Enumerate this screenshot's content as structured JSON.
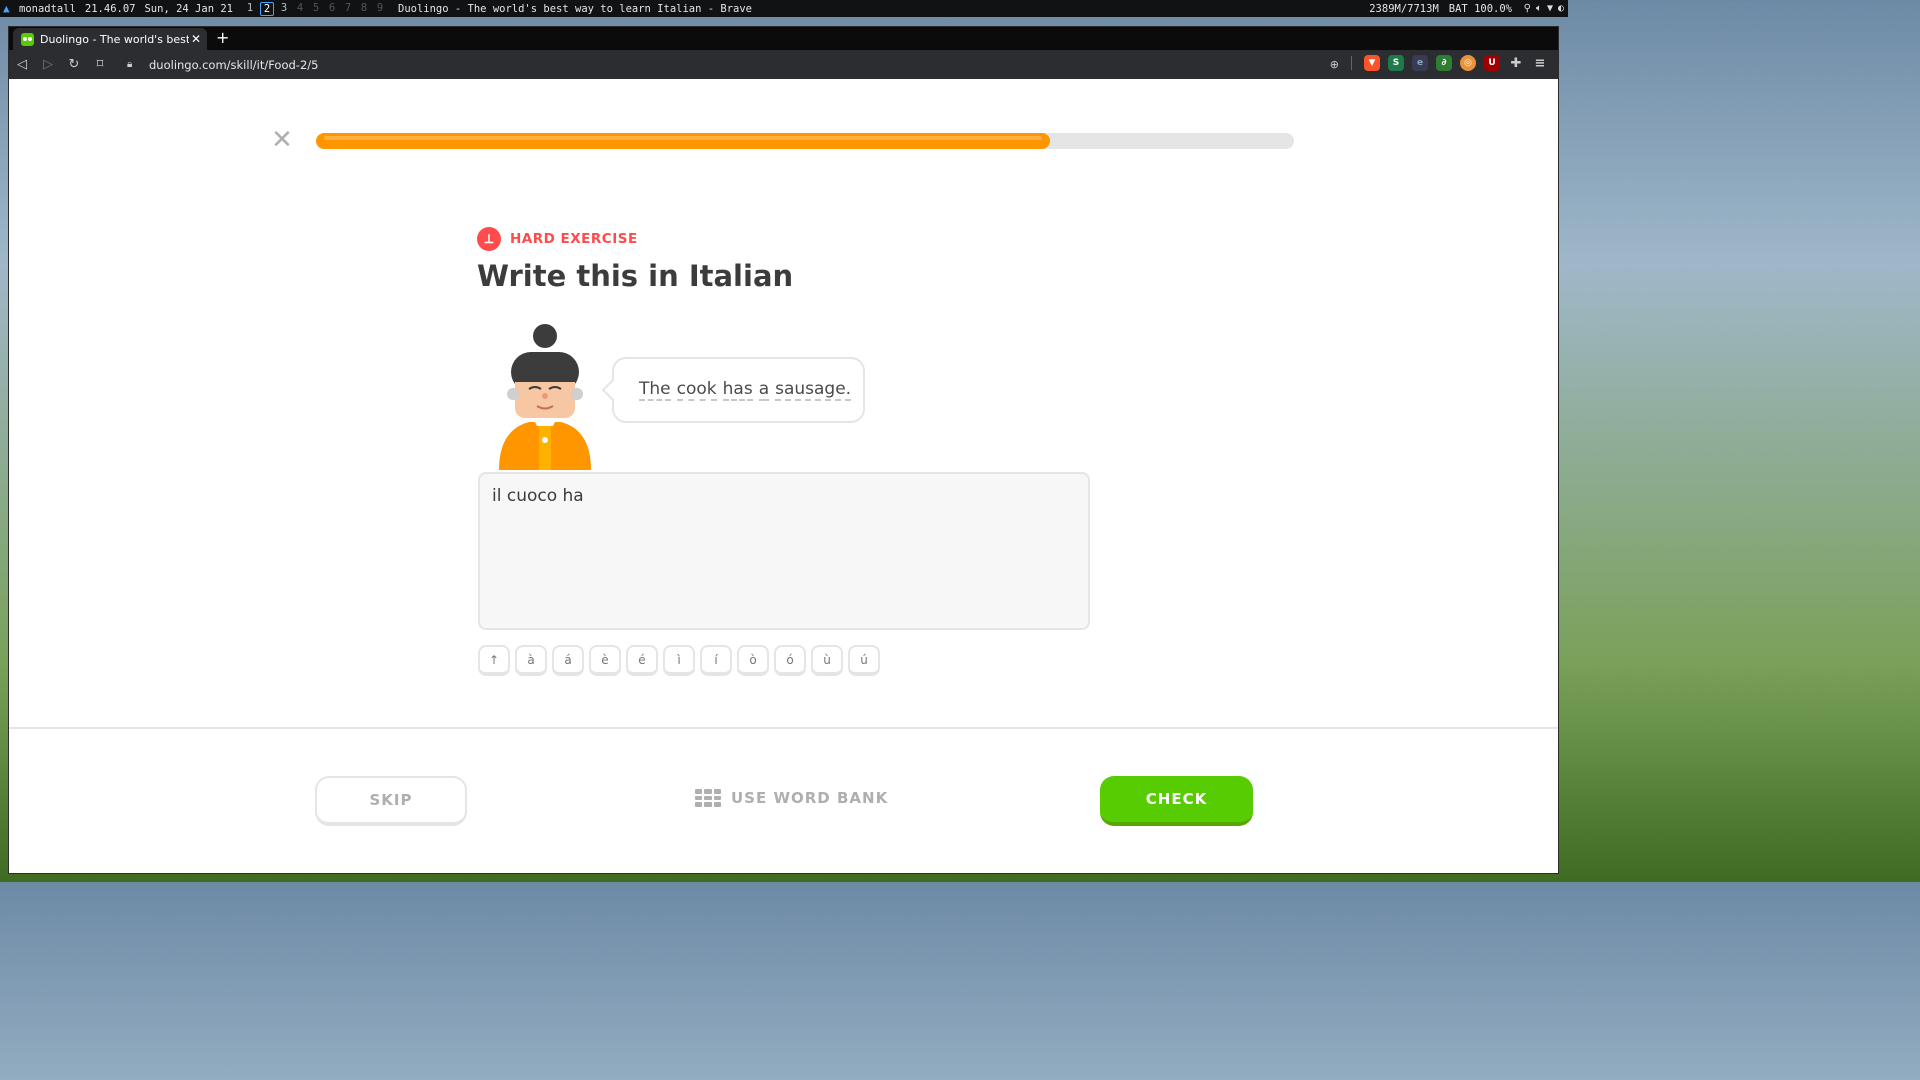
{
  "system_bar": {
    "hostname": "monadtall",
    "time": "21.46.07",
    "date": "Sun, 24 Jan 21",
    "workspaces": [
      "1",
      "2",
      "3",
      "4",
      "5",
      "6",
      "7",
      "8",
      "9"
    ],
    "active_workspace": "2",
    "window_title": "Duolingo - The world's best way to learn Italian - Brave",
    "memory": "2389M/7713M",
    "battery": "BAT 100.0%"
  },
  "browser": {
    "tab_title": "Duolingo - The world's best way to learn Italian",
    "url": "duolingo.com/skill/it/Food-2/5",
    "new_tab_glyph": "+",
    "nav_icons": [
      "back-icon",
      "forward-icon",
      "reload-icon",
      "bookmark-icon"
    ]
  },
  "lesson": {
    "progress_fraction": 0.75,
    "badge": "HARD EXERCISE",
    "heading": "Write this in Italian",
    "prompt_words": [
      "The",
      "cook",
      "has",
      "a",
      "sausage."
    ],
    "answer_value": "il cuoco ha",
    "accent_keys": [
      "↑",
      "à",
      "á",
      "è",
      "é",
      "ì",
      "í",
      "ò",
      "ó",
      "ù",
      "ú"
    ]
  },
  "footer": {
    "skip_label": "SKIP",
    "word_bank_label": "USE WORD BANK",
    "check_label": "CHECK"
  },
  "colors": {
    "progress": "#ff9600",
    "badge": "#ff4b4b",
    "check": "#58cc02",
    "muted": "#afafaf"
  }
}
